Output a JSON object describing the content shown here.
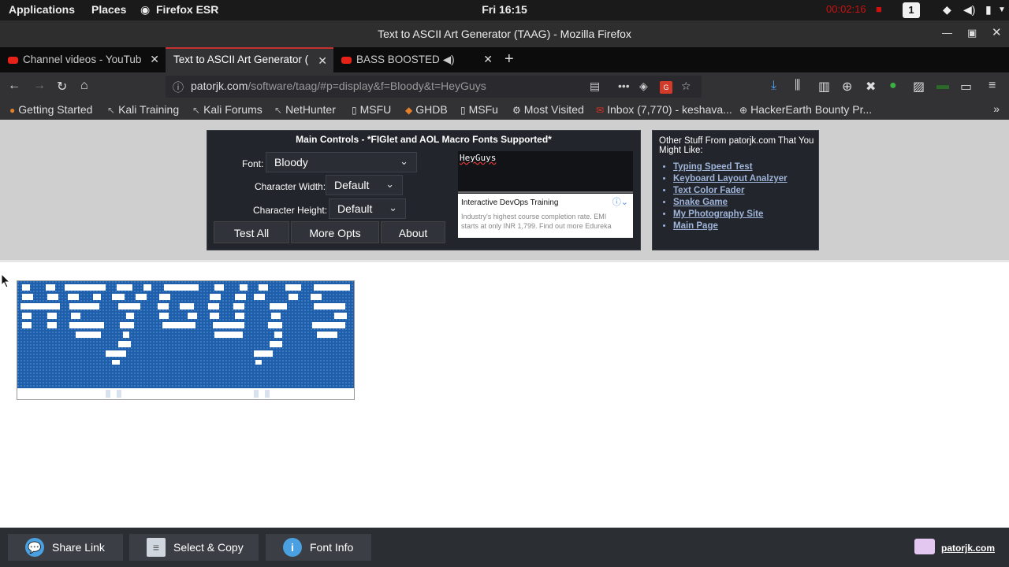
{
  "topbar": {
    "applications": "Applications",
    "places": "Places",
    "app_name": "Firefox ESR",
    "clock": "Fri 16:15",
    "recording_time": "00:02:16",
    "workspace": "1"
  },
  "window": {
    "title": "Text to ASCII Art Generator (TAAG) - Mozilla Firefox"
  },
  "tabs": [
    {
      "label": "Channel videos - YouTub"
    },
    {
      "label": "Text to ASCII Art Generator ("
    },
    {
      "label": "BASS BOOSTED"
    }
  ],
  "navbar": {
    "url_host": "patorjk.com",
    "url_path": "/software/taag/#p=display&f=Bloody&t=HeyGuys"
  },
  "bookmarks": [
    {
      "label": "Getting Started"
    },
    {
      "label": "Kali Training"
    },
    {
      "label": "Kali Forums"
    },
    {
      "label": "NetHunter"
    },
    {
      "label": "MSFU"
    },
    {
      "label": "GHDB"
    },
    {
      "label": "MSFu"
    },
    {
      "label": "Most Visited"
    },
    {
      "label": "Inbox (7,770) - keshava..."
    },
    {
      "label": "HackerEarth Bounty Pr..."
    }
  ],
  "main_controls": {
    "header": "Main Controls - *FIGlet and AOL Macro Fonts Supported*",
    "font_label": "Font:",
    "font_value": "Bloody",
    "char_width_label": "Character Width:",
    "char_width_value": "Default",
    "char_height_label": "Character Height:",
    "char_height_value": "Default",
    "test_all": "Test All",
    "more_opts": "More Opts",
    "about": "About",
    "input_text": "HeyGuys",
    "ad_title": "Interactive DevOps Training",
    "ad_line1": "Industry's highest course completion rate. EMI",
    "ad_line2": "starts at only INR 1,799. Find out more Edureka"
  },
  "side_panel": {
    "header": "Other Stuff From patorjk.com That You Might Like:",
    "links": [
      {
        "label": "Typing Speed Test"
      },
      {
        "label": "Keyboard Layout Analzyer"
      },
      {
        "label": "Text Color Fader"
      },
      {
        "label": "Snake Game"
      },
      {
        "label": "My Photography Site"
      },
      {
        "label": "Main Page"
      }
    ]
  },
  "bottombar": {
    "share_link": "Share Link",
    "select_copy": "Select & Copy",
    "font_info": "Font Info",
    "site": "patorjk.com"
  },
  "colors": {
    "ascii_art_blue": "#1f5ea8",
    "tab_accent": "#c3322e"
  }
}
